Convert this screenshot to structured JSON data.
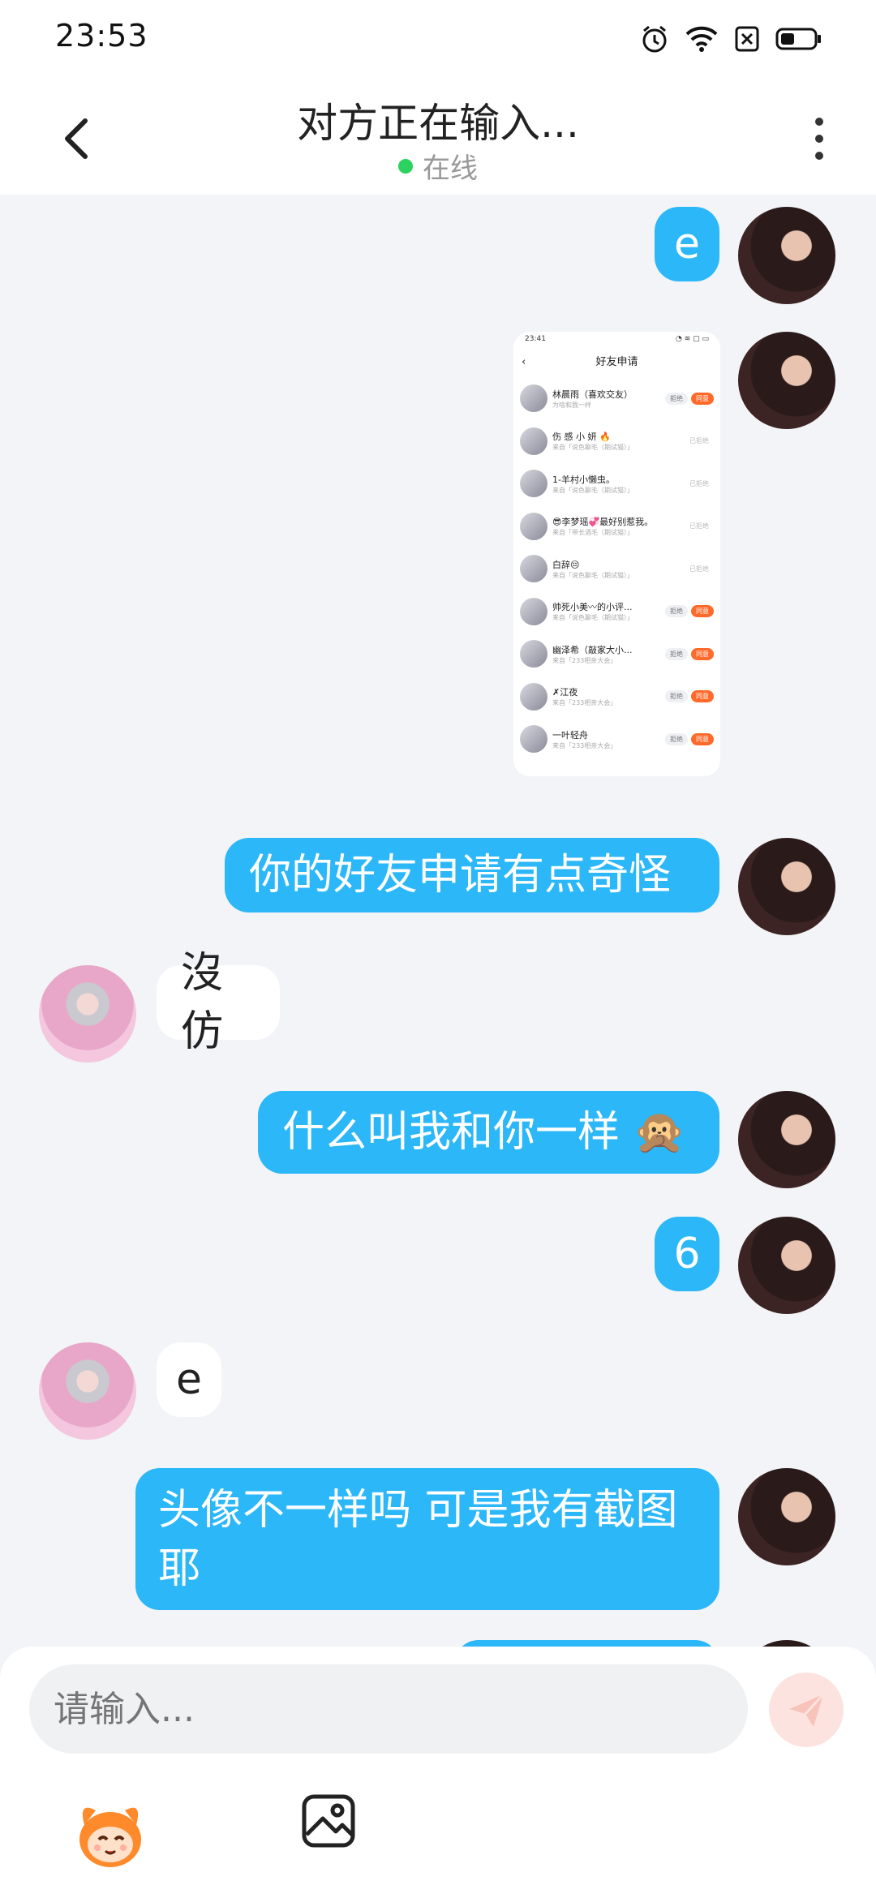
{
  "status_bar": {
    "time": "23:53"
  },
  "header": {
    "title": "对方正在输入...",
    "status": "在线"
  },
  "messages": [
    {
      "side": "out",
      "type": "text",
      "text": "e"
    },
    {
      "side": "out",
      "type": "image"
    },
    {
      "side": "out",
      "type": "text",
      "text": "你的好友申请有点奇怪"
    },
    {
      "side": "in",
      "type": "text",
      "text": "沒仿"
    },
    {
      "side": "out",
      "type": "text",
      "text": "什么叫我和你一样 🙊"
    },
    {
      "side": "out",
      "type": "text",
      "text": "6"
    },
    {
      "side": "in",
      "type": "text",
      "text": "e"
    },
    {
      "side": "out",
      "type": "text",
      "text": "头像不一样吗 可是我有截图耶"
    }
  ],
  "screenshot": {
    "time": "23:41",
    "title": "好友申请",
    "rows": [
      {
        "name": "林晨雨（喜欢交友）",
        "sub": "为啥和我一样",
        "status": "pending",
        "reject": "拒绝",
        "accept": "同意"
      },
      {
        "name": "伤 感 小 妍 🔥",
        "sub": "来自「说色聊毛（期试猫）」",
        "status": "已拒绝"
      },
      {
        "name": "1-羊村小懒虫。",
        "sub": "来自「说色聊毛（期试猫）」",
        "status": "已拒绝"
      },
      {
        "name": "😎李梦瑶💞最好别惹我。",
        "sub": "来自「带长酒毛（期试猫）」",
        "status": "已拒绝"
      },
      {
        "name": "白辞😔",
        "sub": "来自「说色聊毛（期试猫）」",
        "status": "已拒绝"
      },
      {
        "name": "帅死小美〰的小评...",
        "sub": "来自「说色聊毛（期试猫）」",
        "status": "pending",
        "reject": "拒绝",
        "accept": "同意"
      },
      {
        "name": "幽泽希（敲家大小...",
        "sub": "来自「233相亲大会」",
        "status": "pending",
        "reject": "拒绝",
        "accept": "同意"
      },
      {
        "name": "✗江夜",
        "sub": "来自「233相亲大会」",
        "status": "pending",
        "reject": "拒绝",
        "accept": "同意"
      },
      {
        "name": "一叶轻舟",
        "sub": "来自「233相亲大会」",
        "status": "pending",
        "reject": "拒绝",
        "accept": "同意"
      }
    ]
  },
  "input": {
    "placeholder": "请输入..."
  },
  "icons": {
    "back": "chevron-left-icon",
    "more": "more-vertical-icon",
    "send": "send-icon",
    "emoji": "emoji-mascot-icon",
    "image": "image-icon"
  },
  "colors": {
    "outgoing_bubble": "#2bb7f8",
    "incoming_bubble": "#ffffff",
    "online_dot": "#2bd25f",
    "accept_button": "#ff6a2b"
  }
}
